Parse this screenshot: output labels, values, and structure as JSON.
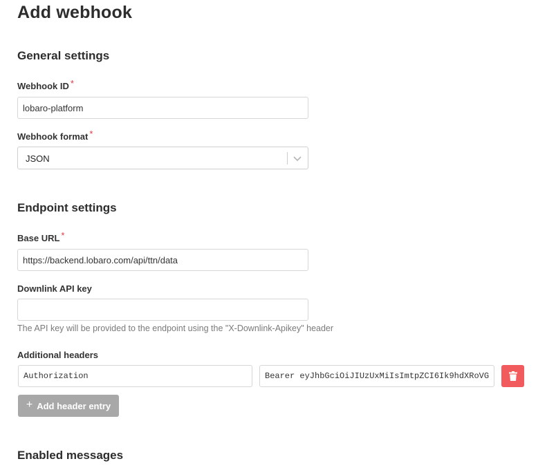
{
  "page": {
    "title": "Add webhook"
  },
  "general": {
    "title": "General settings",
    "webhook_id": {
      "label": "Webhook ID",
      "required": "*",
      "value": "lobaro-platform"
    },
    "webhook_format": {
      "label": "Webhook format",
      "required": "*",
      "selected": "JSON"
    }
  },
  "endpoint": {
    "title": "Endpoint settings",
    "base_url": {
      "label": "Base URL",
      "required": "*",
      "value": "https://backend.lobaro.com/api/ttn/data"
    },
    "downlink_key": {
      "label": "Downlink API key",
      "value": "",
      "helper": "The API key will be provided to the endpoint using the \"X-Downlink-Apikey\" header"
    },
    "additional_headers": {
      "label": "Additional headers",
      "entries": [
        {
          "key": "Authorization",
          "value": "Bearer eyJhbGciOiJIUzUxMiIsImtpZCI6Ik9hdXRoVG"
        }
      ],
      "add_label": "Add header entry"
    }
  },
  "enabled_messages": {
    "title": "Enabled messages"
  },
  "colors": {
    "danger": "#f25b5e",
    "required": "#e0393e",
    "disabled_button": "#a8a8a8"
  },
  "icons": {
    "delete": "trash-icon",
    "add": "plus-icon",
    "dropdown": "chevron-down-icon"
  }
}
